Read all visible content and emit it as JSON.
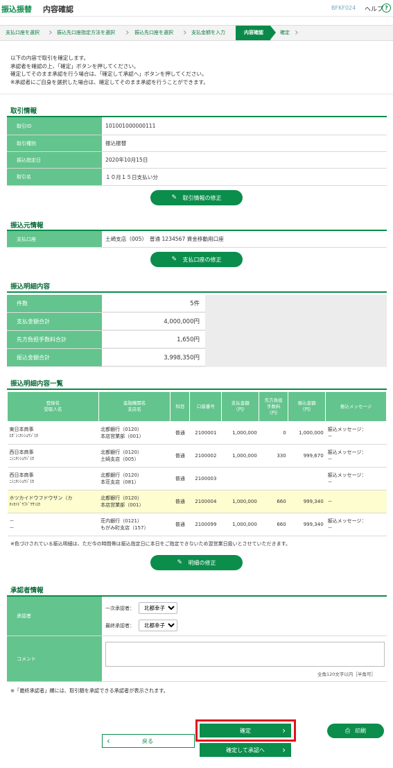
{
  "header": {
    "title": "振込振替",
    "subtitle": "内容確認",
    "screen_code": "BFKF024",
    "help_label": "ヘルプ",
    "help_icon": "?"
  },
  "steps": [
    "支払口座を選択",
    "振込先口座指定方法を選択",
    "振込先口座を選択",
    "支払金額を入力",
    "内容確認",
    "確定"
  ],
  "intro": [
    "以下の内容で取引を確定します。",
    "承認者を確認の上、「確定」ボタンを押してください。",
    "確定してそのまま承認を行う場合は、「確定して承認へ」ボタンを押してください。",
    "※承認者にご自身を選択した場合は、確定してそのまま承認を行うことができます。"
  ],
  "transaction": {
    "title": "取引情報",
    "rows": [
      {
        "label": "取引ID",
        "value": "101001000000111"
      },
      {
        "label": "取引種別",
        "value": "振込振替"
      },
      {
        "label": "振込指定日",
        "value": "2020年10月15日"
      },
      {
        "label": "取引名",
        "value": "１０月１５日支払い分"
      }
    ],
    "edit_button": "取引情報の修正"
  },
  "source": {
    "title": "振込元情報",
    "label": "支払口座",
    "value": "土崎支店（005）　普通 1234567 資金移動用口座",
    "edit_button": "支払口座の修正"
  },
  "summary": {
    "title": "振込明細内容",
    "rows": [
      {
        "label": "件数",
        "value": "5件"
      },
      {
        "label": "支払金額合計",
        "value": "4,000,000円"
      },
      {
        "label": "先方負担手数料合計",
        "value": "1,650円"
      },
      {
        "label": "振込金額合計",
        "value": "3,998,350円"
      }
    ]
  },
  "list": {
    "title": "振込明細内容一覧",
    "headers": {
      "name": "登録名",
      "name2": "受取人名",
      "bank": "金融機関名",
      "bank2": "支店名",
      "type": "科目",
      "account": "口座番号",
      "pay": "支払金額",
      "pay2": "（円）",
      "fee": "先方負担",
      "fee2": "手数料",
      "fee3": "（円）",
      "amount": "振込金額",
      "amount2": "（円）",
      "message": "振込メッセージ"
    },
    "rows": [
      {
        "name": "東日本商事",
        "name2": "ﾋｶﾞｼﾆﾎﾝｼｮｳｼﾞ(ｶ",
        "bank": "北都銀行（0120）",
        "bank2": "本店営業部（001）",
        "type": "普通",
        "account": "2100001",
        "pay": "1,000,000",
        "fee": "0",
        "amount": "1,000,000",
        "msg": "振込メッセージ：",
        "msg2": "－"
      },
      {
        "name": "西日本商事",
        "name2": "ﾆｼﾆﾎﾝｼｮｳｼﾞ(ｶ",
        "bank": "北都銀行（0120）",
        "bank2": "土崎支店（005）",
        "type": "普通",
        "account": "2100002",
        "pay": "1,000,000",
        "fee": "330",
        "amount": "999,670",
        "msg": "振込メッセージ：",
        "msg2": "－"
      },
      {
        "name": "西日本商事",
        "name2": "ﾆｼﾆﾎﾝｼｮｳｼﾞ(ｶ",
        "bank": "北都銀行（0120）",
        "bank2": "本荘支店（081）",
        "type": "普通",
        "account": "2100003",
        "pay": "",
        "fee": "",
        "amount": "",
        "msg": "振込メッセージ：",
        "msg2": "－"
      },
      {
        "name": "ホツカイドウフドウサン（カ",
        "name2": "ﾎｯｶｲﾄﾞｳﾌﾄﾞｳｻﾝ(ｶ",
        "bank": "北都銀行（0120）",
        "bank2": "本店営業部（001）",
        "type": "普通",
        "account": "2100004",
        "pay": "1,000,000",
        "fee": "660",
        "amount": "999,340",
        "msg": "－",
        "msg2": "",
        "highlight": true
      },
      {
        "name": "－",
        "name2": "－",
        "bank": "荘内銀行（0121）",
        "bank2": "もがみ町支店（157）",
        "type": "普通",
        "account": "2100099",
        "pay": "1,000,000",
        "fee": "660",
        "amount": "999,340",
        "msg": "振込メッセージ：",
        "msg2": "－"
      }
    ],
    "note": "※色づけされている振込明細は、ただ今の時間帯は振込指定日に本日をご指定できないため翌営業日扱いとさせていただきます。",
    "edit_button": "明細の修正"
  },
  "approver": {
    "title": "承認者情報",
    "label": "承認者",
    "first_label": "一次承認者：",
    "first_value": "北都幸子",
    "final_label": "最終承認者：",
    "final_value": "北都幸子",
    "comment_label": "コメント",
    "comment_hint": "全角120文字以内［半角可］",
    "note": "※「最終承認者」欄には、取引額を承認できる承認者が表示されます。"
  },
  "buttons": {
    "back": "戻る",
    "confirm": "確定",
    "confirm_approve": "確定して承認へ",
    "print": "印刷"
  },
  "colors": {
    "brand": "#0b8d4c",
    "label_bg": "#63c48d",
    "highlight": "#fdfdd0",
    "focus": "#e0141b"
  }
}
